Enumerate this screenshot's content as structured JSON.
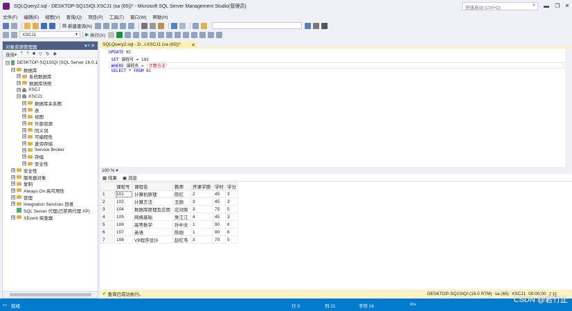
{
  "window": {
    "title": "SQLQuery2.sql - DESKTOP-SQ1SIQI.XSCJ1 (sa (65))* - Microsoft SQL Server Management Studio(管理员)",
    "quick_launch_placeholder": "快速启动 (Ctrl+Q)",
    "min": "▬",
    "restore": "❐",
    "close": "✕"
  },
  "menu": [
    "文件(F)",
    "编辑(E)",
    "视图(V)",
    "查询(Q)",
    "项目(P)",
    "工具(T)",
    "窗口(W)",
    "帮助(H)"
  ],
  "toolbar": {
    "new_query": "新建查询(N)",
    "database": "XSCJ1",
    "execute": "执行(X)"
  },
  "object_explorer": {
    "title": "对象资源管理器",
    "pin": "▾ ᵖ ✕",
    "connect": "连接▾",
    "nodes": [
      {
        "label": "DESKTOP-SQ1SIQI (SQL Server 16.0.1",
        "exp": "⊟",
        "icon": "server-icon"
      },
      {
        "label": "数据库",
        "exp": "⊟",
        "icon": "folder-icon"
      },
      {
        "label": "系统数据库",
        "exp": "⊞",
        "icon": "folder-icon"
      },
      {
        "label": "数据库快照",
        "exp": "⊞",
        "icon": "folder-icon"
      },
      {
        "label": "XSCJ",
        "exp": "⊞",
        "icon": "database-icon"
      },
      {
        "label": "XSCJ1",
        "exp": "⊟",
        "icon": "database-icon"
      },
      {
        "label": "数据库关系图",
        "exp": "⊞",
        "icon": "folder-icon"
      },
      {
        "label": "表",
        "exp": "⊞",
        "icon": "folder-icon"
      },
      {
        "label": "视图",
        "exp": "⊞",
        "icon": "folder-icon"
      },
      {
        "label": "外部资源",
        "exp": "⊞",
        "icon": "folder-icon"
      },
      {
        "label": "同义词",
        "exp": "⊞",
        "icon": "folder-icon"
      },
      {
        "label": "可编程性",
        "exp": "⊞",
        "icon": "folder-icon"
      },
      {
        "label": "查询存储",
        "exp": "⊞",
        "icon": "folder-icon"
      },
      {
        "label": "Service Broker",
        "exp": "⊞",
        "icon": "folder-icon"
      },
      {
        "label": "存储",
        "exp": "⊞",
        "icon": "folder-icon"
      },
      {
        "label": "安全性",
        "exp": "⊞",
        "icon": "folder-icon"
      },
      {
        "label": "安全性",
        "exp": "⊞",
        "icon": "folder-icon"
      },
      {
        "label": "服务器对象",
        "exp": "⊞",
        "icon": "folder-icon"
      },
      {
        "label": "复制",
        "exp": "⊞",
        "icon": "folder-icon"
      },
      {
        "label": "Always On 高可用性",
        "exp": "⊞",
        "icon": "folder-icon"
      },
      {
        "label": "管理",
        "exp": "⊞",
        "icon": "folder-icon"
      },
      {
        "label": "Integration Services 目录",
        "exp": "⊞",
        "icon": "folder-icon"
      },
      {
        "label": "SQL Server 代理(已禁用代理 XP)",
        "exp": "",
        "icon": "agent-icon"
      },
      {
        "label": "XEvent 探查器",
        "exp": "⊞",
        "icon": "folder-icon"
      }
    ]
  },
  "editor": {
    "tab_label": "SQLQuery2.sql - D...I.XSCJ1 (sa (65))*",
    "tab_close": "✕",
    "line1_kw": "UPDATE",
    "line1_rest": " KC",
    "line2_kw": "SET",
    "line2_rest": " 课程号 = 102",
    "line3_kw": "WHERE",
    "line3_mid": " 课程名 = ",
    "line3_str": "'计算方法'",
    "line4_kw1": "SELECT",
    "line4_mid": " * ",
    "line4_kw2": "FROM",
    "line4_rest": " KC",
    "zoom": "100 %"
  },
  "results": {
    "tab_results": "结果",
    "tab_messages": "消息",
    "columns": [
      "课程号",
      "课程名",
      "教师",
      "开课学期",
      "学时",
      "学分"
    ],
    "rows": [
      [
        "1",
        "101",
        "计算机原理",
        "陈红",
        "2",
        "45",
        "3"
      ],
      [
        "2",
        "102",
        "计算方法",
        "王颜",
        "3",
        "45",
        "3"
      ],
      [
        "3",
        "104",
        "数据库原理及应用",
        "应对刚",
        "3",
        "75",
        "5"
      ],
      [
        "4",
        "105",
        "网络基础",
        "吴江江",
        "4",
        "45",
        "3"
      ],
      [
        "5",
        "106",
        "高等数学",
        "孙中文",
        "1",
        "90",
        "6"
      ],
      [
        "6",
        "107",
        "英语",
        "陈刚",
        "1",
        "90",
        "6"
      ],
      [
        "7",
        "108",
        "VB程序设计",
        "赵红韦",
        "3",
        "70",
        "5"
      ]
    ]
  },
  "status": {
    "message": "查询已成功执行。",
    "server": "DESKTOP-SQ1SIQI (16.0 RTM)",
    "user": "sa (65)",
    "db": "XSCJ1",
    "time": "00:00:00",
    "rows": "7 行"
  },
  "bottom_bar": {
    "ready": "就绪",
    "line": "行 3",
    "col": "列 21",
    "char": "字符 16",
    "ins": "Ins"
  },
  "watermark": "CSDN @君竹止"
}
